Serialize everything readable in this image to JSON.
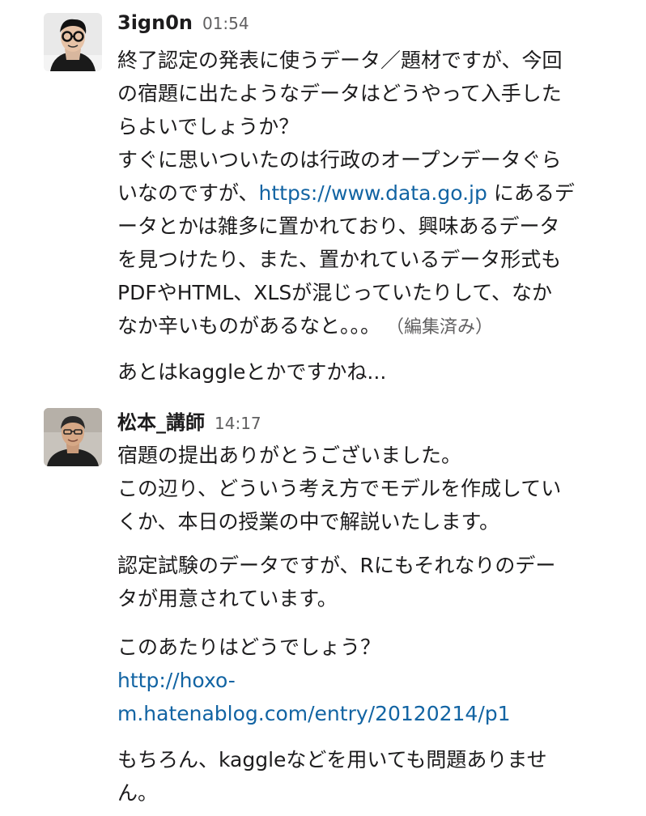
{
  "messages": [
    {
      "author": "3ign0n",
      "time": "01:54",
      "lines": {
        "l1": "終了認定の発表に使うデータ／題材ですが、今回",
        "l2": "の宿題に出たようなデータはどうやって入手した",
        "l3": "らよいでしょうか？",
        "l4": "すぐに思いついたのは行政のオープンデータぐら",
        "l5a": "いなのですが、",
        "l5_link": "https://www.data.go.jp",
        "l5b": " にあるデ",
        "l6": "ータとかは雑多に置かれており、興味あるデータ",
        "l7": "を見つけたり、また、置かれているデータ形式も",
        "l8": "PDFやHTML、XLSが混じっていたりして、なか",
        "l9": "なか辛いものがあるなと。。。",
        "edited": "（編集済み）",
        "l10": "あとはkaggleとかですかね..."
      }
    },
    {
      "author": "松本_講師",
      "time": "14:17",
      "lines": {
        "l1": "宿題の提出ありがとうございました。",
        "l2": "この辺り、どういう考え方でモデルを作成してい",
        "l3": "くか、本日の授業の中で解説いたします。",
        "l4": "認定試験のデータですが、Rにもそれなりのデー",
        "l5": "タが用意されています。",
        "l6": "このあたりはどうでしょう？",
        "link1": "http://hoxo-",
        "link2": "m.hatenablog.com/entry/20120214/p1",
        "l7": "もちろん、kaggleなどを用いても問題ありませ",
        "l8": "ん。"
      }
    }
  ],
  "colors": {
    "text": "#1d1c1d",
    "muted": "#616061",
    "link": "#1264a3"
  }
}
